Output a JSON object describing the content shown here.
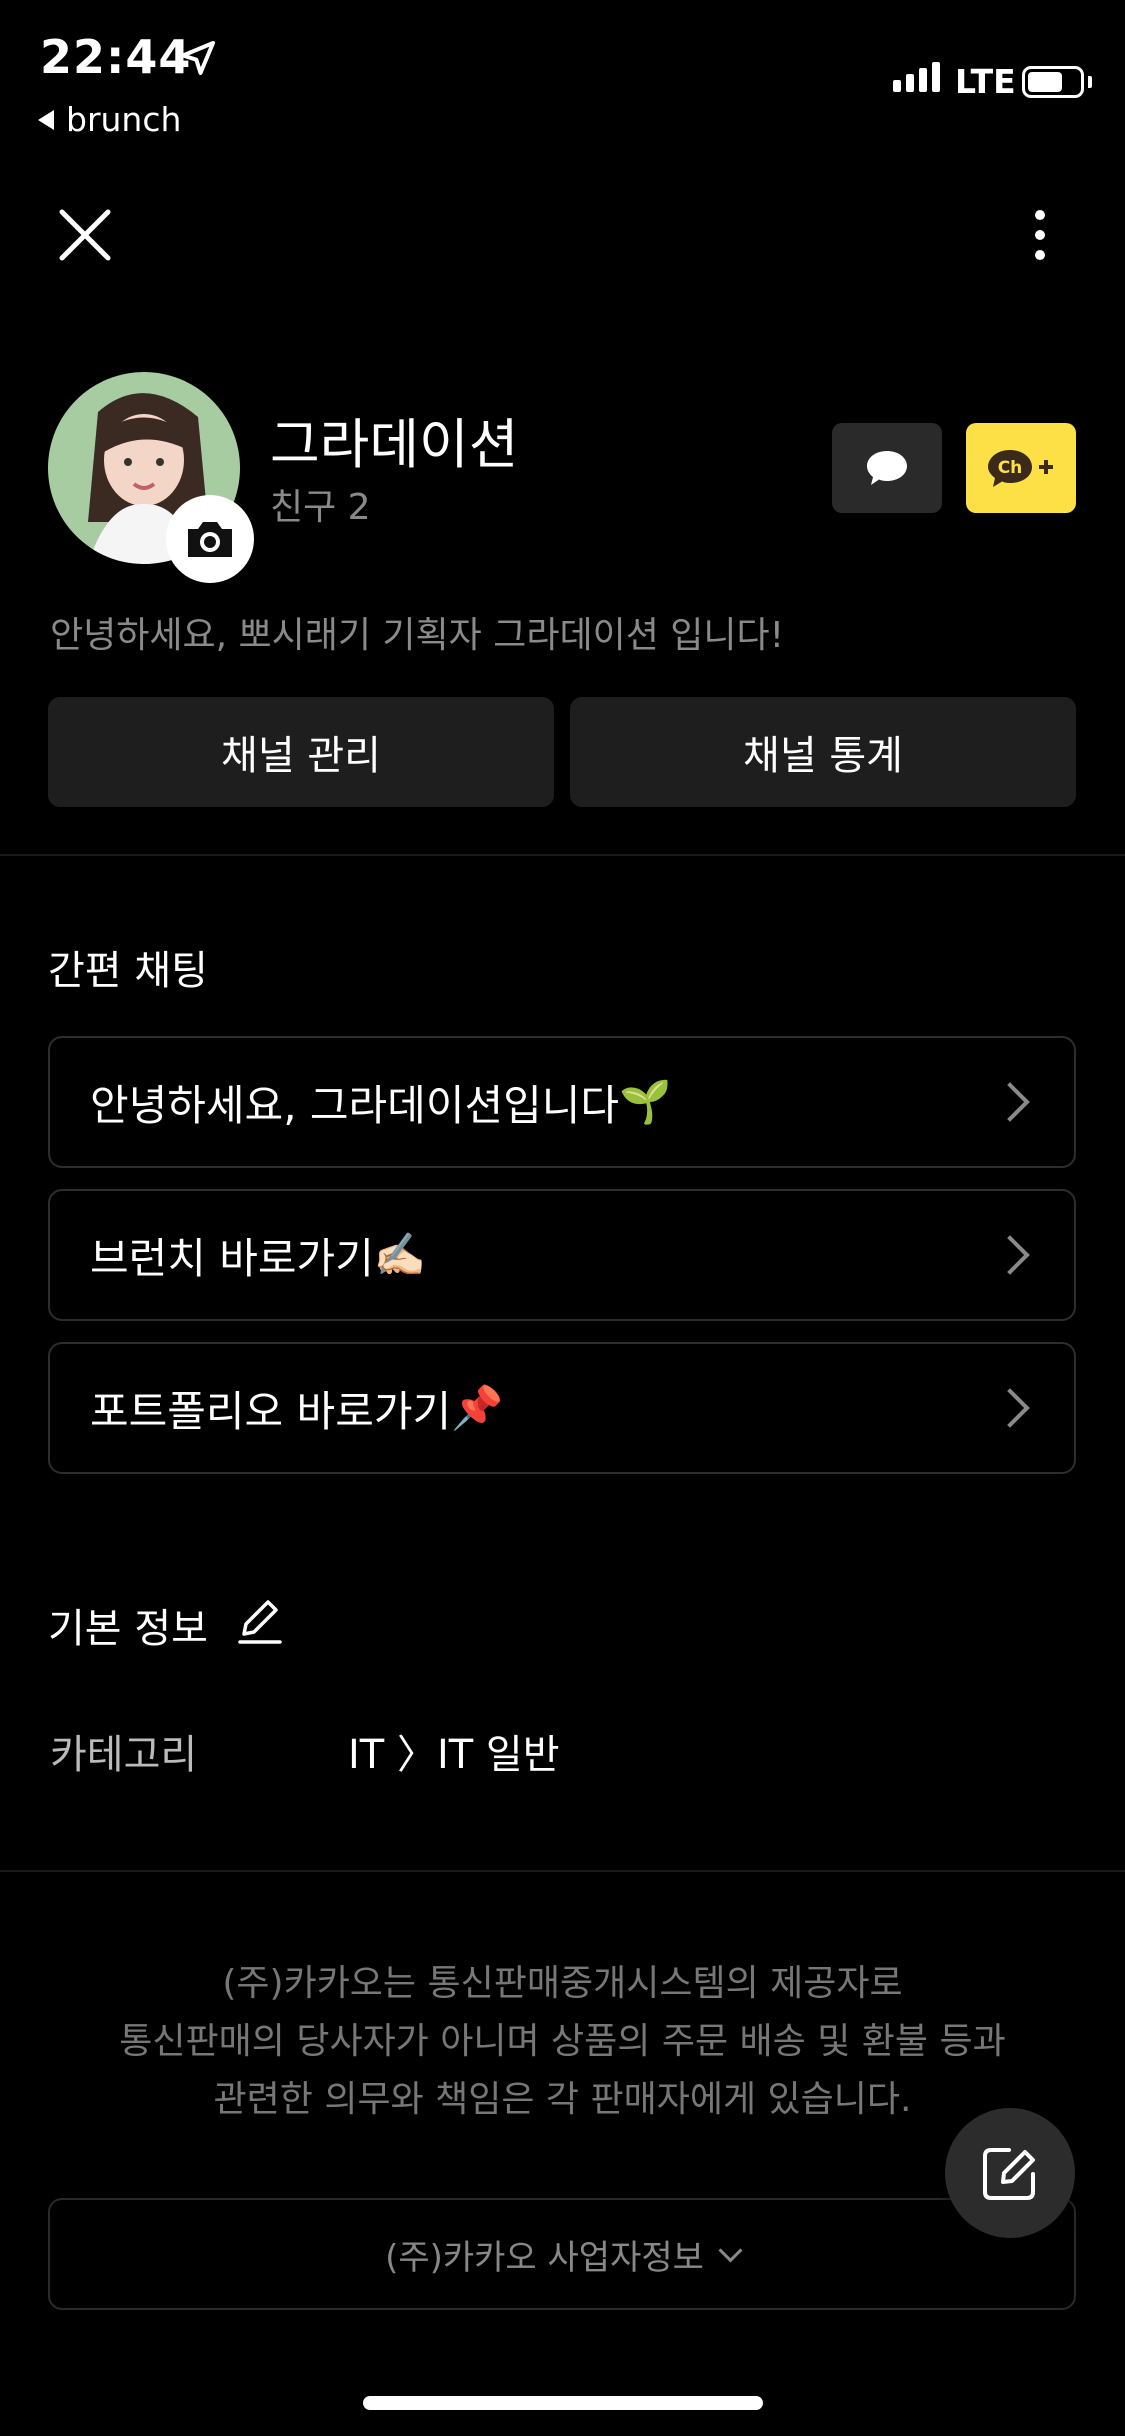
{
  "status_bar": {
    "time": "22:44",
    "back_app": "brunch",
    "network": "LTE"
  },
  "profile": {
    "name": "그라데이션",
    "friends": "친구 2",
    "intro": "안녕하세요, 뽀시래기 기획자 그라데이션 입니다!",
    "ch_badge": "Ch"
  },
  "actions": {
    "manage": "채널 관리",
    "stats": "채널 통계"
  },
  "quick_chat": {
    "title": "간편 채팅",
    "items": [
      {
        "label": "안녕하세요,  그라데이션입니다",
        "emoji": "🌱"
      },
      {
        "label": "브런치 바로가기",
        "emoji": "✍🏻"
      },
      {
        "label": "포트폴리오 바로가기",
        "emoji": "📌"
      }
    ]
  },
  "basic_info": {
    "title": "기본 정보",
    "category_label": "카테고리",
    "category_value": "IT 〉IT 일반"
  },
  "footer": {
    "notice_lines": [
      "(주)카카오는 통신판매중개시스템의 제공자로",
      "통신판매의 당사자가 아니며 상품의 주문 배송 및 환불 등과",
      "관련한 의무와 책임은 각 판매자에게 있습니다."
    ],
    "biz_info": "(주)카카오 사업자정보"
  },
  "colors": {
    "accent_yellow": "#fde045",
    "background": "#000000",
    "avatar_bg": "#a7cca1"
  }
}
